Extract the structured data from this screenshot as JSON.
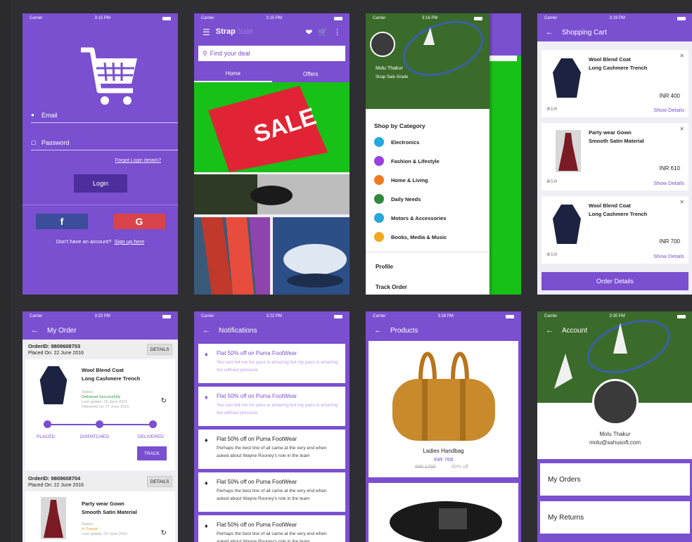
{
  "colors": {
    "accent": "#7a4fd0",
    "dark": "#4d2e9c",
    "green": "#14c414",
    "red": "#d9434b",
    "fb": "#3b4d9b"
  },
  "status_bar": {
    "carrier": "Carrier",
    "times": [
      "3:15 PM",
      "3:15 PM",
      "3:16 PM",
      "3:19 PM",
      "3:20 PM",
      "3:22 PM",
      "3:26 PM",
      "3:30 PM"
    ]
  },
  "login": {
    "email_placeholder": "Email",
    "password_placeholder": "Password",
    "forgot": "Forgot Login details?",
    "login_button": "Login",
    "facebook": "f",
    "google": "G",
    "no_account": "Don't have an account?",
    "signup": "Sign up here"
  },
  "home": {
    "brand": "Strap",
    "brand2": "Sale",
    "search_placeholder": "Find your deal",
    "tabs": [
      "Home",
      "Offers"
    ],
    "banner": "SALE"
  },
  "drawer": {
    "user": "Molu Thakur",
    "subtitle": "Strap Sale Grade",
    "heading": "Shop by Category",
    "categories": [
      "Electronics",
      "Fashion & Lifestyle",
      "Home & Living",
      "Daily Needs",
      "Motors & Accessories",
      "Books, Media & Music"
    ],
    "links": [
      "Profile",
      "Track Order"
    ]
  },
  "cart": {
    "title": "Shopping Cart",
    "items": [
      {
        "name1": "Wool Blend Coat",
        "name2": "Long Cashmere Trench",
        "price": "INR 400",
        "qty": "1",
        "details": "Show Details"
      },
      {
        "name1": "Party wear Gown",
        "name2": "Smooth Satin Material",
        "price": "INR 610",
        "qty": "1",
        "details": "Show Details"
      },
      {
        "name1": "Wool Blend Coat",
        "name2": "Long Cashmere Trench",
        "price": "INR 700",
        "qty": "1",
        "details": "Show Details"
      }
    ],
    "order_button": "Order Details"
  },
  "orders": {
    "title": "My Order",
    "list": [
      {
        "id": "OrderID: 9809608703",
        "placed": "Placed On: 22 June 2016",
        "details": "DETAILS",
        "name1": "Wool Blend Coat",
        "name2": "Long Cashmere Trench",
        "status_label": "Status:",
        "status": "Delivered Successfully",
        "update": "Last update: 26 June 2016",
        "delivered": "Delivered on: 27 June 2016",
        "steps": [
          "PLACED",
          "DISPATCHED",
          "DELIVERED"
        ],
        "track": "TRACK"
      },
      {
        "id": "OrderID: 9809608704",
        "placed": "Placed On: 22 June 2016",
        "details": "DETAILS",
        "name1": "Party wear Gown",
        "name2": "Smooth Satin Material",
        "status_label": "Status:",
        "status": "In Transit",
        "update": "Last update: 26 June 2016"
      }
    ]
  },
  "notifications": {
    "title": "Notifications",
    "items": [
      {
        "title": "Flat 50% off on Puma FootWear",
        "desc": "You can tell me his pass is amazing but my pass is amazing too without pressure"
      },
      {
        "title": "Flat 50% off on Puma FootWear",
        "desc": "You can tell me his pass is amazing but my pass is amazing too without pressure"
      },
      {
        "title": "Flat 50% off on Puma FootWear",
        "desc": "Perhaps the best line of all came at the very end when asked about Wayne Rooney's role in the team"
      },
      {
        "title": "Flat 50% off on Puma FootWear",
        "desc": "Perhaps the best line of all came at the very end when asked about Wayne Rooney's role in the team"
      },
      {
        "title": "Flat 50% off on Puma FootWear",
        "desc": "Perhaps the best line of all came at the very end when asked about Wayne Rooney's role in the team"
      }
    ]
  },
  "products": {
    "title": "Products",
    "item": {
      "name": "Ladies Handbag",
      "price": "INR 768",
      "old": "INR 1700",
      "off": "60% off"
    }
  },
  "account": {
    "title": "Account",
    "name": "Molu Thakur",
    "email": "molu@sahusoft.com",
    "menu": [
      "My Orders",
      "My Returns"
    ]
  }
}
